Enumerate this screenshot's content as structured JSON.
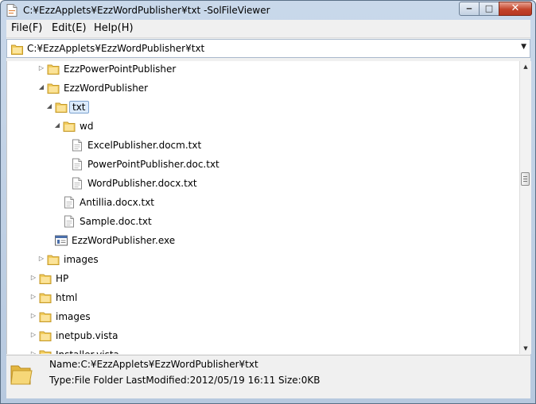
{
  "window": {
    "title": "C:¥EzzApplets¥EzzWordPublisher¥txt -SolFileViewer",
    "minimize_glyph": "‒",
    "maximize_glyph": "□",
    "close_glyph": "✕"
  },
  "menu": {
    "file": "File(F)",
    "edit": "Edit(E)",
    "help": "Help(H)"
  },
  "pathbar": {
    "path": "C:¥EzzApplets¥EzzWordPublisher¥txt",
    "dropdown_icon": "chevron-down-icon"
  },
  "tree": {
    "items": [
      {
        "label": "EzzPowerPointPublisher",
        "type": "folder",
        "expander": "collapsed",
        "depth": 2
      },
      {
        "label": "EzzWordPublisher",
        "type": "folder",
        "expander": "expanded",
        "depth": 2
      },
      {
        "label": "txt",
        "type": "folder",
        "expander": "expanded",
        "depth": 3,
        "selected": true
      },
      {
        "label": "wd",
        "type": "folder",
        "expander": "expanded",
        "depth": 4
      },
      {
        "label": "ExcelPublisher.docm.txt",
        "type": "file",
        "expander": "none",
        "depth": 5
      },
      {
        "label": "PowerPointPublisher.doc.txt",
        "type": "file",
        "expander": "none",
        "depth": 5
      },
      {
        "label": "WordPublisher.docx.txt",
        "type": "file",
        "expander": "none",
        "depth": 5
      },
      {
        "label": "Antillia.docx.txt",
        "type": "file",
        "expander": "none",
        "depth": 4
      },
      {
        "label": "Sample.doc.txt",
        "type": "file",
        "expander": "none",
        "depth": 4
      },
      {
        "label": "EzzWordPublisher.exe",
        "type": "exe",
        "expander": "none",
        "depth": 3
      },
      {
        "label": "images",
        "type": "folder",
        "expander": "collapsed",
        "depth": 2
      },
      {
        "label": "HP",
        "type": "folder",
        "expander": "collapsed",
        "depth": 1
      },
      {
        "label": "html",
        "type": "folder",
        "expander": "collapsed",
        "depth": 1
      },
      {
        "label": "images",
        "type": "folder",
        "expander": "collapsed",
        "depth": 1
      },
      {
        "label": "inetpub.vista",
        "type": "folder",
        "expander": "collapsed",
        "depth": 1
      },
      {
        "label": "Installer.vista",
        "type": "folder",
        "expander": "collapsed",
        "depth": 1
      }
    ]
  },
  "status": {
    "name": "Name:C:¥EzzApplets¥EzzWordPublisher¥txt",
    "info": "Type:File Folder   LastModified:2012/05/19 16:11   Size:0KB"
  },
  "colors": {
    "title_bar": "#bcd0e8",
    "selection": "#dcebfc",
    "folder": "#f2cc5c",
    "close_button": "#c3442a"
  }
}
